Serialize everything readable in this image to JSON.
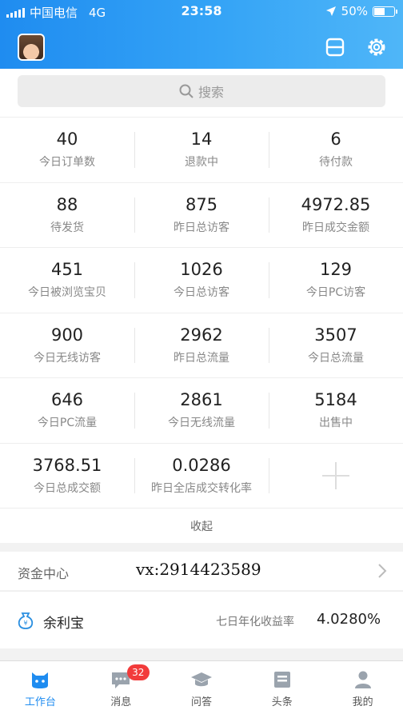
{
  "status_bar": {
    "carrier": "中国电信",
    "network": "4G",
    "time": "23:58",
    "battery": "50%",
    "battery_level": 0.5
  },
  "header": {
    "avatar_icon": "avatar-photo",
    "scan_icon": "scan-icon",
    "settings_icon": "gear-icon"
  },
  "search": {
    "placeholder": "搜索"
  },
  "stats": [
    [
      {
        "value": "40",
        "label": "今日订单数"
      },
      {
        "value": "14",
        "label": "退款中"
      },
      {
        "value": "6",
        "label": "待付款"
      }
    ],
    [
      {
        "value": "88",
        "label": "待发货"
      },
      {
        "value": "875",
        "label": "昨日总访客"
      },
      {
        "value": "4972.85",
        "label": "昨日成交金额"
      }
    ],
    [
      {
        "value": "451",
        "label": "今日被浏览宝贝"
      },
      {
        "value": "1026",
        "label": "今日总访客"
      },
      {
        "value": "129",
        "label": "今日PC访客"
      }
    ],
    [
      {
        "value": "900",
        "label": "今日无线访客"
      },
      {
        "value": "2962",
        "label": "昨日总流量"
      },
      {
        "value": "3507",
        "label": "今日总流量"
      }
    ],
    [
      {
        "value": "646",
        "label": "今日PC流量"
      },
      {
        "value": "2861",
        "label": "今日无线流量"
      },
      {
        "value": "5184",
        "label": "出售中"
      }
    ],
    [
      {
        "value": "3768.51",
        "label": "今日总成交额"
      },
      {
        "value": "0.0286",
        "label": "昨日全店成交转化率"
      }
    ]
  ],
  "collapse_label": "收起",
  "fund_center": {
    "title": "资金中心",
    "overlay_text": "vx:2914423589"
  },
  "yuebao": {
    "name": "余利宝",
    "rate_label": "七日年化收益率",
    "rate": "4.0280%",
    "icon": "money-bag-icon"
  },
  "tabs": [
    {
      "label": "工作台",
      "icon": "workbench-icon",
      "active": true
    },
    {
      "label": "消息",
      "icon": "message-icon",
      "badge": "32"
    },
    {
      "label": "问答",
      "icon": "graduation-cap-icon"
    },
    {
      "label": "头条",
      "icon": "news-icon"
    },
    {
      "label": "我的",
      "icon": "profile-icon"
    }
  ],
  "colors": {
    "primary": "#1f8cf0",
    "badge": "#f23b3b"
  }
}
